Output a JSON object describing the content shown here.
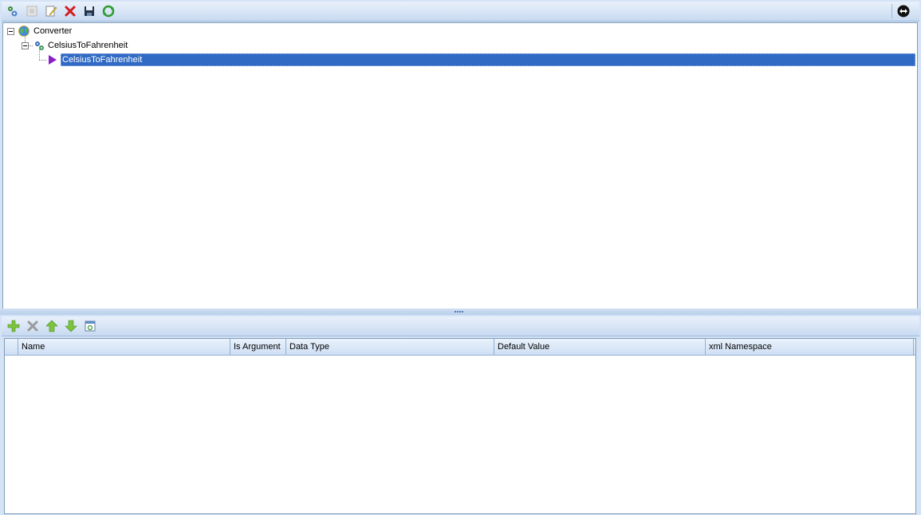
{
  "top_toolbar": {
    "buttons": [
      {
        "icon": "add-service-icon"
      },
      {
        "icon": "add-operation-icon",
        "disabled": true
      },
      {
        "icon": "edit-icon"
      },
      {
        "icon": "delete-icon"
      },
      {
        "icon": "save-icon"
      },
      {
        "icon": "refresh-icon"
      }
    ],
    "right_button": {
      "icon": "toggle-arrows-icon"
    }
  },
  "tree": {
    "root": {
      "label": "Converter",
      "icon": "globe-icon",
      "expanded": true
    },
    "service": {
      "label": "CelsiusToFahrenheit",
      "icon": "gears-icon",
      "expanded": true
    },
    "operation": {
      "label": "CelsiusToFahrenheit",
      "icon": "play-arrow-icon",
      "selected": true
    }
  },
  "bottom_toolbar": {
    "buttons": [
      {
        "icon": "add-icon"
      },
      {
        "icon": "remove-icon",
        "disabled": true
      },
      {
        "icon": "move-up-icon"
      },
      {
        "icon": "move-down-icon"
      },
      {
        "icon": "properties-icon"
      }
    ]
  },
  "grid": {
    "columns": [
      "Name",
      "Is Argument",
      "Data Type",
      "Default Value",
      "xml Namespace"
    ],
    "rows": []
  },
  "colors": {
    "selection": "#316ac5",
    "background": "#d4e3f5",
    "header": "#cfdff4"
  }
}
